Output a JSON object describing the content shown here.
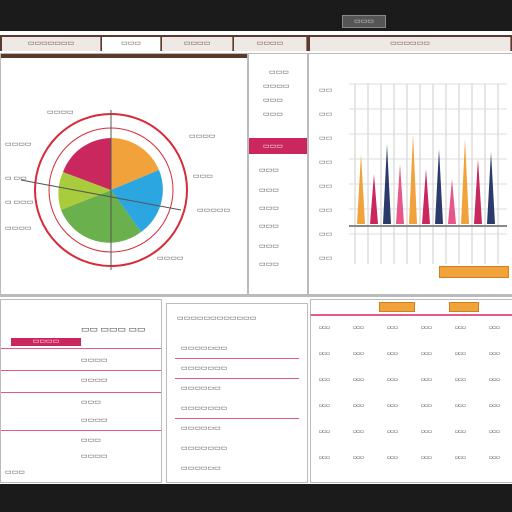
{
  "window": {
    "title": "▭▭▭"
  },
  "tabs": [
    {
      "label": "▭▭▭▭▭▭▭"
    },
    {
      "label": "▭▭▭"
    },
    {
      "label": "▭▭▭▭"
    },
    {
      "label": "▭▭▭▭"
    },
    {
      "label": "▭▭▭▭▭▭"
    }
  ],
  "pie_panel": {
    "labels": [
      "▭▭▭▭",
      "▭▭▭▭",
      "▭ ▭▭",
      "▭ ▭▭▭",
      "▭▭▭▭"
    ],
    "right_labels": [
      "▭▭▭▭",
      "▭▭▭",
      "▭▭▭▭▭",
      "▭▭▭▭"
    ]
  },
  "middle_panel": {
    "rows": [
      "▭▭▭",
      "▭▭▭▭",
      "▭▭▭",
      "▭▭▭",
      "▭▭▭",
      "▭▭▭",
      "▭▭▭",
      "▭▭▭",
      "▭▭▭",
      "▭▭▭"
    ],
    "highlight": "▭▭▭"
  },
  "spike_chart": {
    "y_ticks": [
      "▭▭",
      "▭▭",
      "▭▭",
      "▭▭",
      "▭▭",
      "▭▭",
      "▭▭",
      "▭▭"
    ],
    "colors": [
      "#f2a23a",
      "#c9275e",
      "#2a3a6a",
      "#e8578a"
    ]
  },
  "bottom_left": {
    "title": "▭▭ ▭▭▭ ▭▭",
    "tag": "▭▭▭▭",
    "rows": [
      "▭▭▭▭",
      "▭▭▭▭",
      "▭▭▭",
      "▭▭▭▭",
      "▭▭▭",
      "▭▭▭▭",
      "▭▭▭"
    ]
  },
  "bottom_mid": {
    "header": "▭▭▭▭▭▭▭▭▭▭▭▭",
    "rows": [
      "▭▭▭▭▭▭▭",
      "▭▭▭▭▭▭▭",
      "▭▭▭▭▭▭",
      "▭▭▭▭▭▭▭",
      "▭▭▭▭▭▭",
      "▭▭▭▭▭▭▭",
      "▭▭▭▭▭▭"
    ]
  },
  "bottom_right": {
    "headers": [
      "▭▭▭▭▭",
      "▭▭▭"
    ],
    "grid": [
      [
        "▭▭▭",
        "▭▭▭",
        "▭▭▭",
        "▭▭▭",
        "▭▭▭",
        "▭▭▭"
      ],
      [
        "▭▭▭",
        "▭▭▭",
        "▭▭▭",
        "▭▭▭",
        "▭▭▭",
        "▭▭▭"
      ],
      [
        "▭▭▭",
        "▭▭▭",
        "▭▭▭",
        "▭▭▭",
        "▭▭▭",
        "▭▭▭"
      ],
      [
        "▭▭▭",
        "▭▭▭",
        "▭▭▭",
        "▭▭▭",
        "▭▭▭",
        "▭▭▭"
      ],
      [
        "▭▭▭",
        "▭▭▭",
        "▭▭▭",
        "▭▭▭",
        "▭▭▭",
        "▭▭▭"
      ],
      [
        "▭▭▭",
        "▭▭▭",
        "▭▭▭",
        "▭▭▭",
        "▭▭▭",
        "▭▭▭"
      ]
    ]
  },
  "colors": {
    "accent": "#c9275e",
    "brand_bar": "#5a3a2c",
    "orange": "#f2a23a"
  }
}
